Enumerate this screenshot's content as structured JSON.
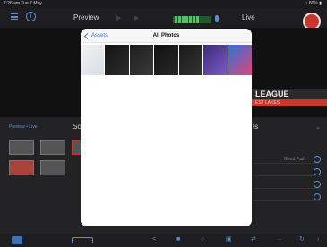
{
  "status_bar": {
    "time": "7:26 am  Tue 7 May",
    "right": "↑ 80% ▮"
  },
  "toolbar": {
    "preview_label": "Preview",
    "live_label": "Live"
  },
  "live_graphics": {
    "league": "LEAGUE",
    "league_sub": "EST LAKES"
  },
  "lower_panel": {
    "tabs": "Preview  •  Live",
    "section_left": "Sc",
    "section_right": "ts",
    "score_label": "Good Pad"
  },
  "photo_picker": {
    "back_label": "Assets",
    "title": "All Photos",
    "photos": [
      {
        "name": "document",
        "colors": [
          "#f2f2f2",
          "#d8dde6"
        ]
      },
      {
        "name": "dark-screen-1",
        "colors": [
          "#151515",
          "#2c2c2c"
        ]
      },
      {
        "name": "dark-screen-2",
        "colors": [
          "#1e1e1e",
          "#3a3a3a"
        ]
      },
      {
        "name": "dark-screen-3",
        "colors": [
          "#101010",
          "#2a2a2a"
        ]
      },
      {
        "name": "dark-screen-4",
        "colors": [
          "#1a1a1a",
          "#333333"
        ]
      },
      {
        "name": "purple-wallpaper",
        "colors": [
          "#3b2a7a",
          "#7b5bc8"
        ]
      },
      {
        "name": "colorful-wallpaper",
        "colors": [
          "#2f74d8",
          "#e0457a"
        ]
      }
    ]
  },
  "colors": {
    "accent": "#5a8fd6",
    "record": "#c9372c",
    "meter": "#3fcf55"
  }
}
